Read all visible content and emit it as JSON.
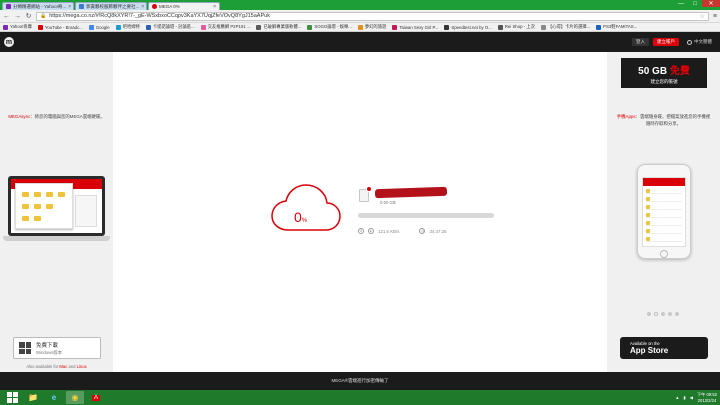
{
  "browser": {
    "tabs": [
      {
        "title": "分類精選網站 - Yahoo!奇...",
        "color": "#7b2bb5"
      },
      {
        "title": "郭貴夥校服飾夥伴之要社...",
        "color": "#3a7bd5"
      },
      {
        "title": "MEGA 0%",
        "color": "#d90007"
      }
    ],
    "url": "https://mega.co.nz/#!RcQ8kXYR!7-_gE-WSxbxoCCqpv3KaYX7UqjZfeVOvQ8YgJ15aAPuk",
    "window_controls": {
      "minimize": "—",
      "maximize": "□",
      "close": "✕"
    }
  },
  "bookmarks": [
    {
      "label": "Yahoo!奇摩",
      "color": "#7b2bb5"
    },
    {
      "label": "YouTube - Broadc...",
      "color": "#d90007"
    },
    {
      "label": "Google",
      "color": "#4285f4"
    },
    {
      "label": "吧哈姆特",
      "color": "#1e9bd0"
    },
    {
      "label": "卡提諾論壇 - 討論區...",
      "color": "#2b5fb3"
    },
    {
      "label": "交友推薦網 P2P101 ...",
      "color": "#e35b9c"
    },
    {
      "label": "已破解專業版軟體...",
      "color": "#5a5a5a"
    },
    {
      "label": "SOGO論壇 - 娛樂...",
      "color": "#3f8f3f"
    },
    {
      "label": "夢幻的旅遊",
      "color": "#e58f1b"
    },
    {
      "label": "Taiwan Sexy Girl P...",
      "color": "#c2185b"
    },
    {
      "label": "Speedtest.net by O...",
      "color": "#333333"
    },
    {
      "label": "Rei Shop - 上次",
      "color": "#555555"
    },
    {
      "label": "【心得】卡片的選擇...",
      "color": "#888888"
    },
    {
      "label": "PS3鞋FAMITAS...",
      "color": "#1565c0"
    }
  ],
  "header": {
    "logo": "m",
    "login_label": "登入",
    "register_label": "建立帳戶",
    "language_label": "中文簡體"
  },
  "left_panel": {
    "promo_brand": "MEGAsync",
    "promo_text": "：將您的電腦與您的MEGA雲端硬碟。",
    "download_title": "免費下載",
    "download_sub": "Windows版本",
    "also_prefix": "Also available for",
    "also_mac": "Mac",
    "also_and": "and",
    "also_linux": "Linux"
  },
  "right_panel": {
    "offer_size": "50 GB",
    "offer_free": "免費",
    "offer_sub": "建立您的帳號",
    "promo_brand": "手機Apps",
    "promo_text": "：雲端隨身碟，把檔案放進您的手機裡隨時存取和分享。",
    "appstore_line1": "Available on the",
    "appstore_line2": "App Store"
  },
  "transfer": {
    "percent": "0",
    "percent_sign": "%",
    "file_size": "0.00 GB",
    "progress": 0,
    "speed": "121.6 KB/s",
    "time_left": "34:47:25"
  },
  "footer": {
    "text": "MEGA®雲端進行加密傳輸了"
  },
  "taskbar": {
    "time": "下午 08:52",
    "date": "2013/2/24",
    "apps": [
      {
        "name": "file-explorer",
        "glyph": "📁"
      },
      {
        "name": "internet-explorer",
        "glyph": "e"
      },
      {
        "name": "chrome",
        "glyph": "◉"
      },
      {
        "name": "antivirus",
        "glyph": "A"
      }
    ]
  },
  "colors": {
    "mega_red": "#d90007",
    "taskbar_green": "#1f7a2c",
    "dark": "#1b1b1b"
  }
}
